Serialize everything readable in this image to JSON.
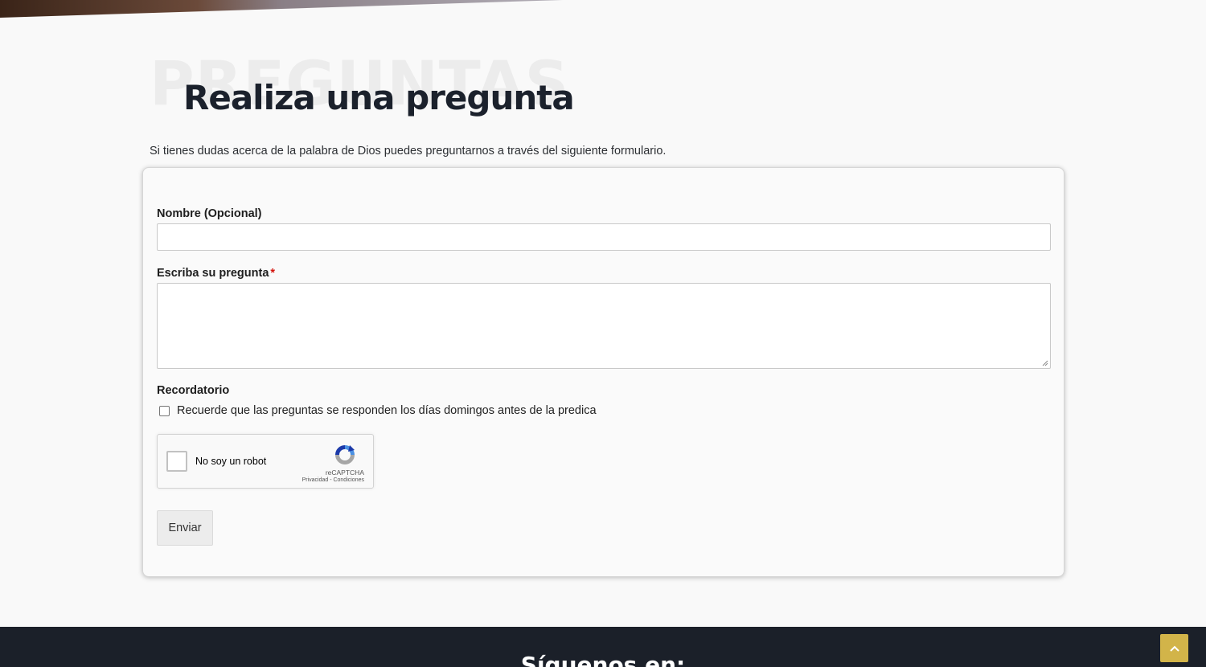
{
  "header": {
    "watermark": "PREGUNTAS",
    "title": "Realiza una pregunta",
    "intro": "Si tienes dudas acerca de la palabra de Dios puedes preguntarnos a través del siguiente formulario."
  },
  "form": {
    "name_label": "Nombre (Opcional)",
    "name_value": "",
    "question_label": "Escriba su pregunta",
    "required_mark": "*",
    "question_value": "",
    "reminder_label": "Recordatorio",
    "reminder_text": "Recuerde que las preguntas se responden los días domingos antes de la predica",
    "reminder_checked": false,
    "submit_label": "Enviar"
  },
  "recaptcha": {
    "label": "No soy un robot",
    "brand": "reCAPTCHA",
    "links": "Privacidad - Condiciones"
  },
  "footer": {
    "heading": "Síguenos en:"
  },
  "icons": {
    "back_to_top": "chevron-up-icon",
    "recaptcha_logo": "recaptcha-icon"
  },
  "colors": {
    "background": "#f9f9f9",
    "title": "#1b212c",
    "footer": "#1b2029",
    "accent": "#d2b449",
    "required": "#d4130c"
  }
}
